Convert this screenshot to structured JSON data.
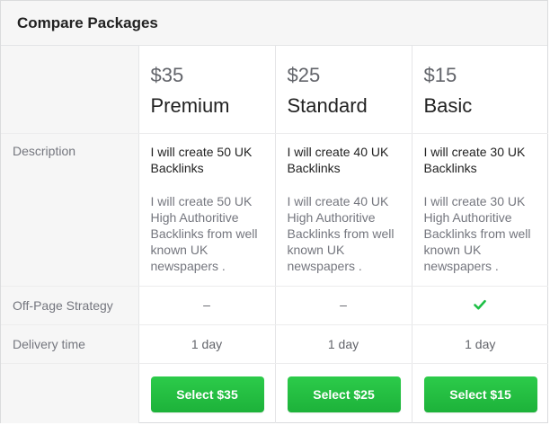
{
  "header": {
    "title": "Compare Packages"
  },
  "labels": {
    "description": "Description",
    "off_page": "Off-Page Strategy",
    "delivery": "Delivery time"
  },
  "accent_color": "#1dbf45",
  "packages": [
    {
      "price": "$35",
      "name": "Premium",
      "desc_title": "I will create 50 UK Backlinks",
      "desc_body": "I will create 50 UK High Authoritive Backlinks from well known UK newspapers .",
      "off_page": "–",
      "off_page_included": false,
      "delivery": "1 day",
      "button": "Select $35"
    },
    {
      "price": "$25",
      "name": "Standard",
      "desc_title": "I will create 40 UK Backlinks",
      "desc_body": "I will create 40 UK High Authoritive Backlinks from well known UK newspapers .",
      "off_page": "–",
      "off_page_included": false,
      "delivery": "1 day",
      "button": "Select $25"
    },
    {
      "price": "$15",
      "name": "Basic",
      "desc_title": "I will create 30 UK Backlinks",
      "desc_body": "I will create 30 UK High Authoritive Backlinks from well known UK newspapers .",
      "off_page_included": true,
      "off_page_icon": "checkmark-icon",
      "delivery": "1 day",
      "button": "Select $15"
    }
  ]
}
